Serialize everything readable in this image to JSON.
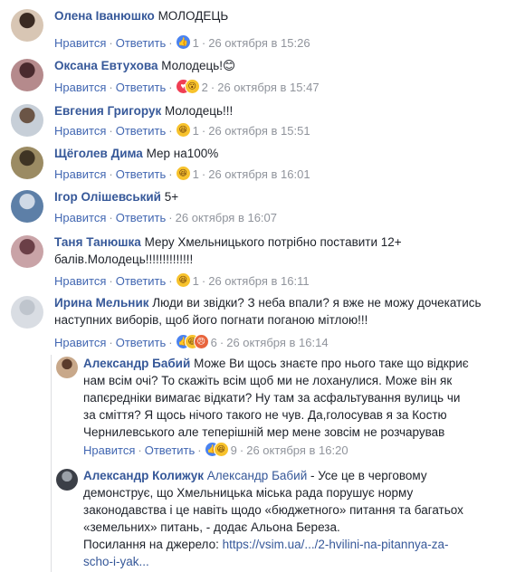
{
  "labels": {
    "like": "Нравится",
    "reply": "Ответить"
  },
  "comments": [
    {
      "author": "Олена Іванюшко",
      "text": "МОЛОДЕЦЬ",
      "reactions": [
        "like"
      ],
      "count": "1",
      "time": "26 октября в 15:26"
    },
    {
      "author": "Оксана Евтухова",
      "text": "Молодець!",
      "emoji": "😊",
      "reactions": [
        "love",
        "wow"
      ],
      "count": "2",
      "time": "26 октября в 15:47"
    },
    {
      "author": "Евгения Григорук",
      "text": "Молодець!!!",
      "reactions": [
        "haha"
      ],
      "count": "1",
      "time": "26 октября в 15:51"
    },
    {
      "author": "Щёголев Дима",
      "text": "Мер на100%",
      "reactions": [
        "haha"
      ],
      "count": "1",
      "time": "26 октября в 16:01"
    },
    {
      "author": "Ігор Олішевський",
      "text": "5+",
      "reactions": [],
      "count": "",
      "time": "26 октября в 16:07"
    },
    {
      "author": "Таня Танюшка",
      "text": "Меру Хмельницького потрібно поставити 12+",
      "text2": "балів.Молодець!!!!!!!!!!!!!!",
      "reactions": [
        "haha"
      ],
      "count": "1",
      "time": "26 октября в 16:11"
    },
    {
      "author": "Ирина Мельник",
      "text": "Люди ви звідки? З неба впали? я вже не можу дочекатись",
      "text2": "наступних виборів, щоб його погнати поганою мітлою!!!",
      "reactions": [
        "like",
        "haha",
        "angry"
      ],
      "count": "6",
      "time": "26 октября в 16:14"
    }
  ],
  "replies": [
    {
      "author": "Александр Бабий",
      "lines": [
        "Може Ви щось знаєте про нього таке що відкриє",
        "нам всім очі? То скажіть всім щоб ми не лоханулися. Може він як",
        "папєредніки вимагає відкати? Ну там за асфальтування вулиць чи",
        "за сміття? Я щось нічого такого не чув. Да,голосував я за Костю",
        "Чернилевського але теперішній мер мене зовсім не розчарував"
      ],
      "reactions": [
        "like",
        "haha"
      ],
      "count": "9",
      "time": "26 октября в 16:20"
    },
    {
      "author": "Александр Колижук",
      "mention": "Александр Бабий",
      "lines": [
        "- Усе це в черговому",
        "демонструє, що Хмельницька міська рада порушує норму",
        "законодавства і це навіть щодо «бюджетного» питання та багатьох",
        "«земельних» питань, - додає Альона Береза.",
        "Посилання на джерело: "
      ],
      "link1": "https://vsim.ua/.../2-hvilini-na-pitannya-za-",
      "link2": "scho-i-yak..."
    }
  ],
  "colors": {
    "name": "#365899",
    "action": "#4267b2",
    "meta": "#90949c"
  }
}
